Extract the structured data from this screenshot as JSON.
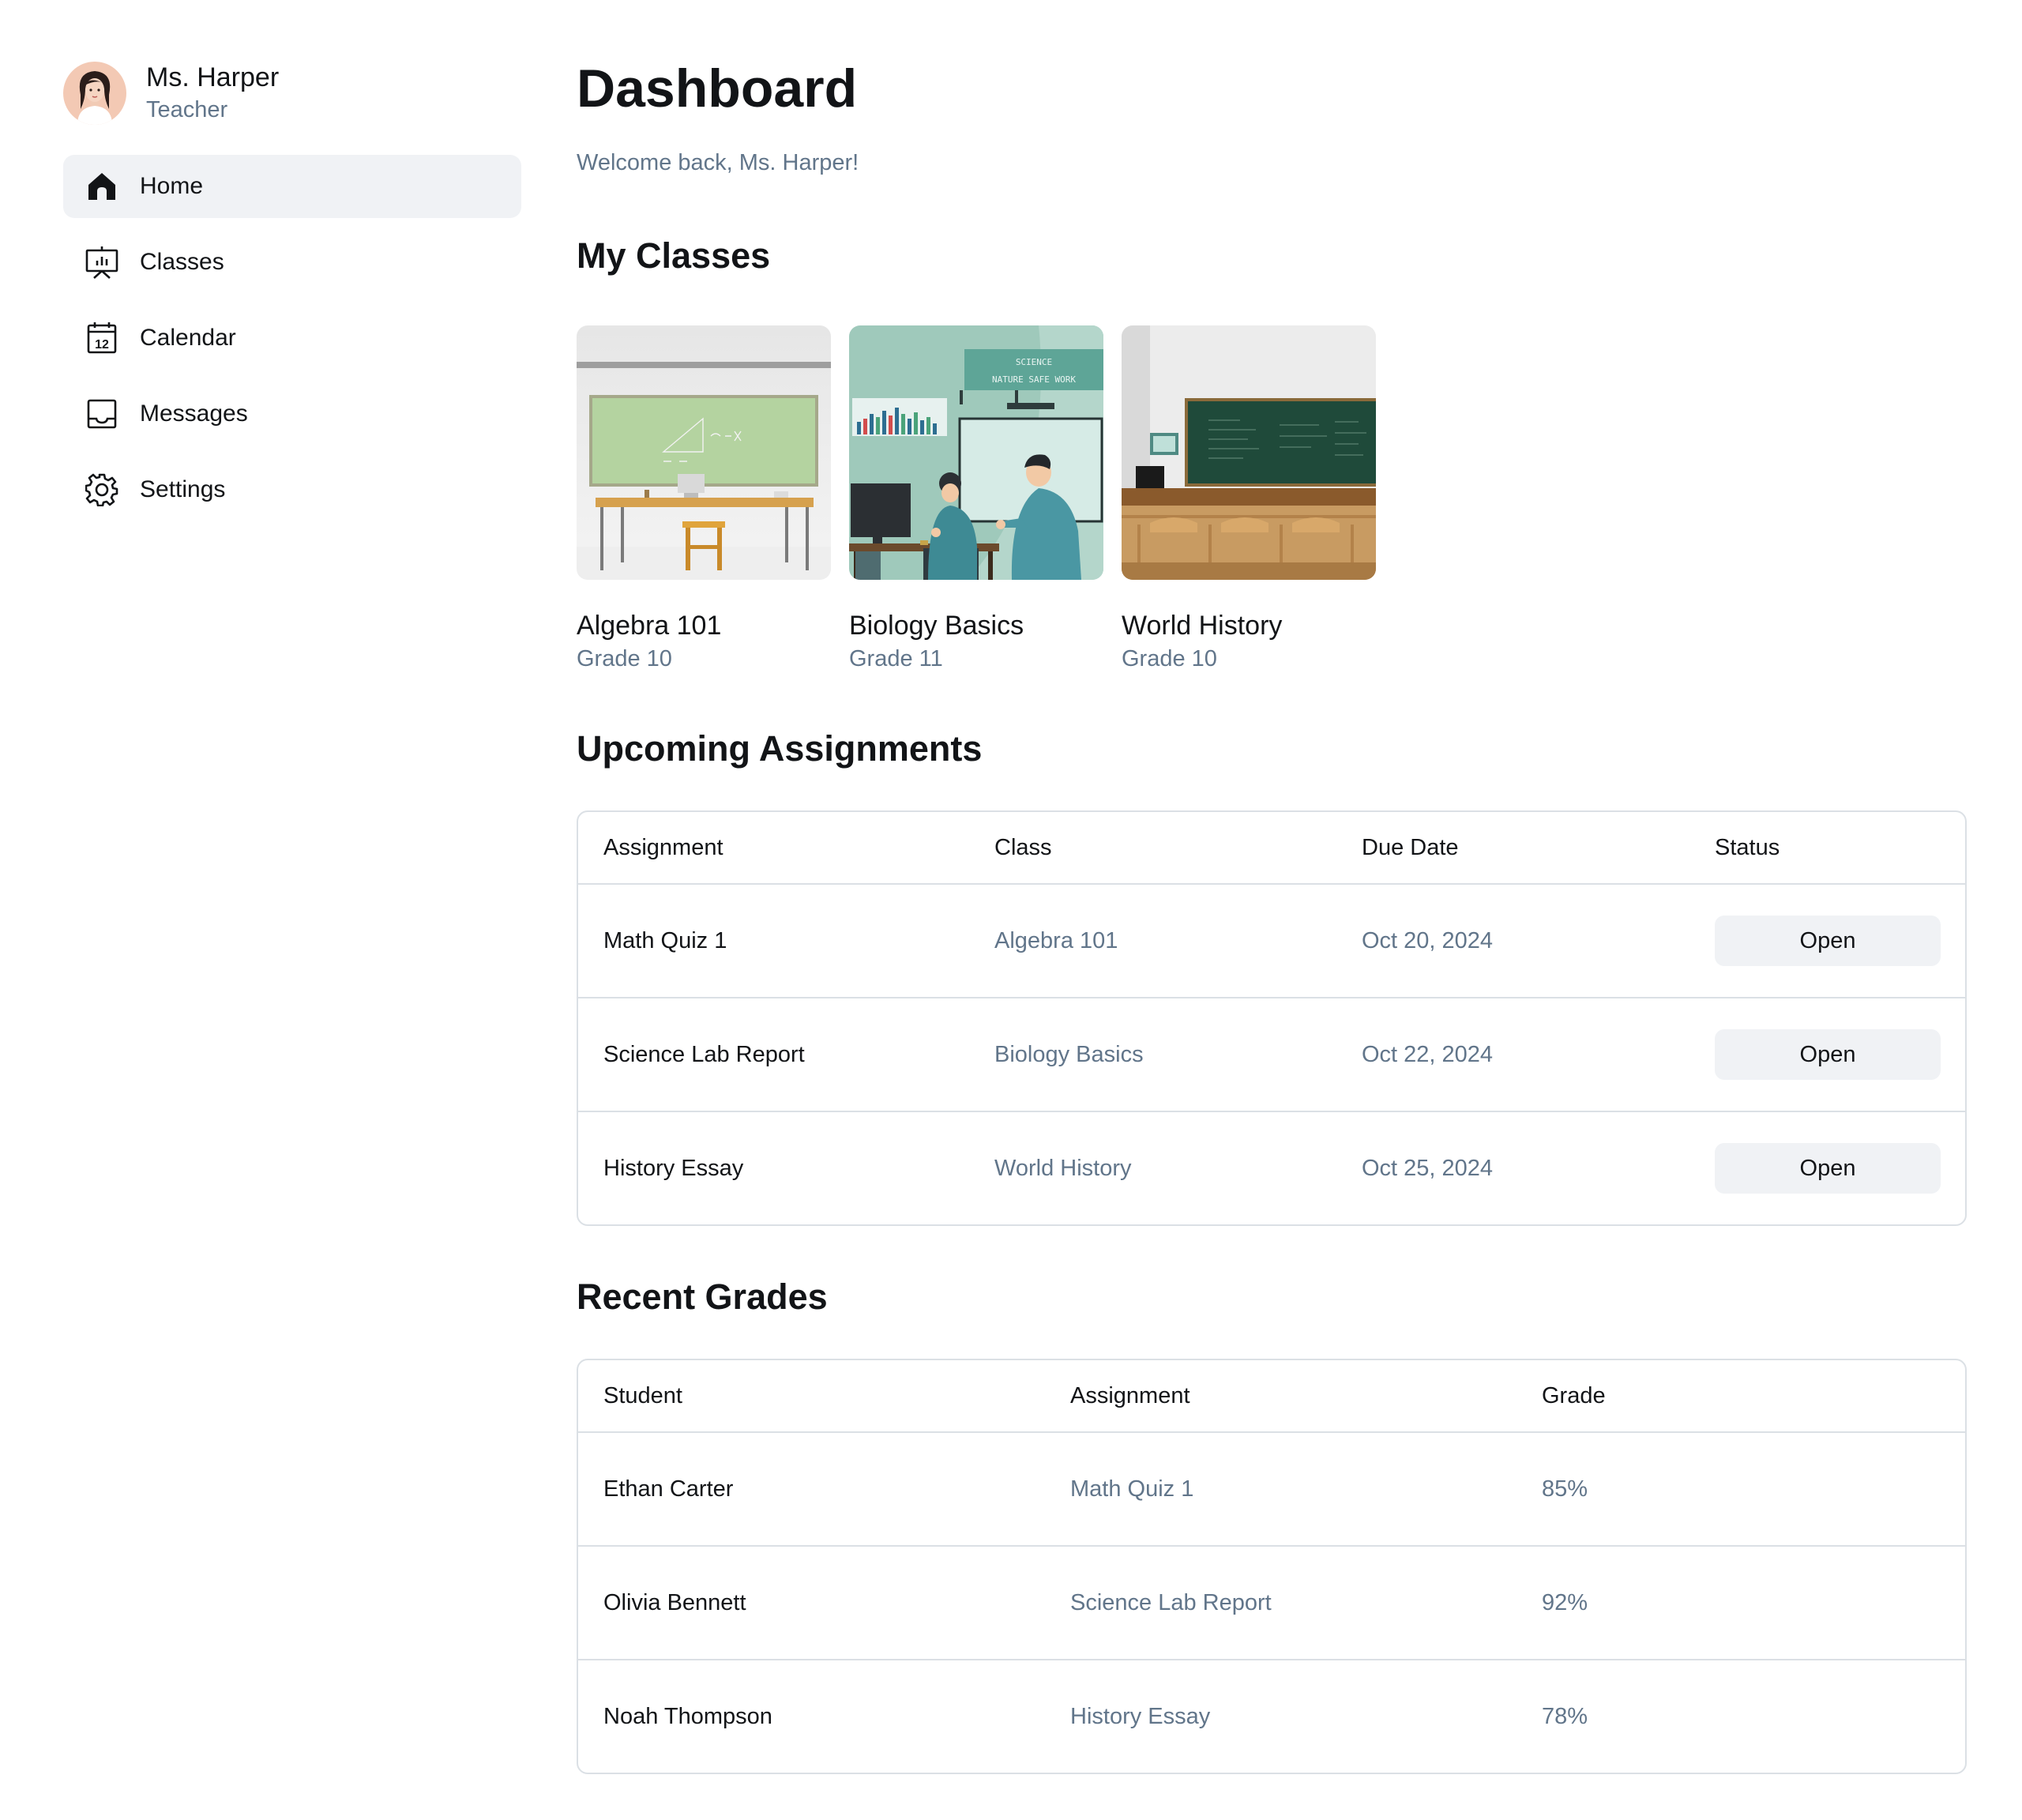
{
  "profile": {
    "name": "Ms. Harper",
    "role": "Teacher"
  },
  "sidebar": {
    "items": [
      {
        "label": "Home",
        "icon": "home-icon",
        "active": true
      },
      {
        "label": "Classes",
        "icon": "presentation-icon",
        "active": false
      },
      {
        "label": "Calendar",
        "icon": "calendar-icon",
        "active": false
      },
      {
        "label": "Messages",
        "icon": "inbox-icon",
        "active": false
      },
      {
        "label": "Settings",
        "icon": "gear-icon",
        "active": false
      }
    ],
    "calendar_icon_day": "12"
  },
  "main": {
    "title": "Dashboard",
    "welcome": "Welcome back, Ms. Harper!",
    "classes_title": "My Classes",
    "classes": [
      {
        "name": "Algebra 101",
        "grade": "Grade 10",
        "image": "classroom-chalkboard-illustration"
      },
      {
        "name": "Biology Basics",
        "grade": "Grade 11",
        "image": "science-lab-illustration"
      },
      {
        "name": "World History",
        "grade": "Grade 10",
        "image": "history-classroom-illustration"
      }
    ],
    "biology_banner": [
      "SCIENCE",
      "NATURE SAFE WORK"
    ],
    "assignments_title": "Upcoming Assignments",
    "assignments": {
      "headers": [
        "Assignment",
        "Class",
        "Due Date",
        "Status"
      ],
      "rows": [
        {
          "assignment": "Math Quiz 1",
          "class": "Algebra 101",
          "due": "Oct 20, 2024",
          "status": "Open"
        },
        {
          "assignment": "Science Lab Report",
          "class": "Biology Basics",
          "due": "Oct 22, 2024",
          "status": "Open"
        },
        {
          "assignment": "History Essay",
          "class": "World History",
          "due": "Oct 25, 2024",
          "status": "Open"
        }
      ]
    },
    "grades_title": "Recent Grades",
    "grades": {
      "headers": [
        "Student",
        "Assignment",
        "Grade"
      ],
      "rows": [
        {
          "student": "Ethan Carter",
          "assignment": "Math Quiz 1",
          "grade": "85%"
        },
        {
          "student": "Olivia Bennett",
          "assignment": "Science Lab Report",
          "grade": "92%"
        },
        {
          "student": "Noah Thompson",
          "assignment": "History Essay",
          "grade": "78%"
        }
      ]
    }
  },
  "colors": {
    "text_primary": "#121417",
    "text_secondary": "#61758a",
    "active_bg": "#f0f2f5",
    "border": "#dbe0e5"
  }
}
